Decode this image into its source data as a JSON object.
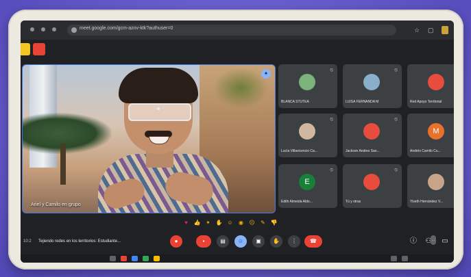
{
  "browser": {
    "url": "meet.google.com/gcm-aznv-ktk?authuser=0",
    "star_icon": "star-icon",
    "extensions_icon": "puzzle-icon"
  },
  "main_speaker": {
    "name": "Ariel y Camilo en grupo"
  },
  "participants": [
    {
      "name": "BLANCA STUTEA",
      "avatar": "",
      "color": "#7bb37a",
      "photo": true
    },
    {
      "name": "LUISA FERNANDA M",
      "avatar": "",
      "color": "#8ab0c9",
      "photo": true
    },
    {
      "name": "Red Apoyo Territorial",
      "avatar": "",
      "color": "#e74c3c",
      "photo": true
    },
    {
      "name": "Lucía Villavicencio Ca...",
      "avatar": "",
      "color": "#d0b8a0",
      "photo": true
    },
    {
      "name": "Jackson Andres Sao...",
      "avatar": "",
      "color": "#e74c3c",
      "photo": true
    },
    {
      "name": "Andrés Camilo Cu...",
      "avatar": "M",
      "color": "#e8712c",
      "photo": false
    },
    {
      "name": "Edith Almeida Aldo...",
      "avatar": "E",
      "color": "#188038",
      "photo": false
    },
    {
      "name": "Tú y otras",
      "avatar": "",
      "color": "#e74c3c",
      "photo": true
    },
    {
      "name": "Yiseth Hernández V...",
      "avatar": "",
      "color": "#c7a48a",
      "photo": true
    }
  ],
  "reactions": [
    "heart",
    "thumbs-up",
    "party",
    "clap",
    "laugh",
    "surprised",
    "sad",
    "thinking",
    "thumbs-down"
  ],
  "bottom_bar": {
    "time": "10:2",
    "meeting_title": "Tejiendo redes en los territorios: Estudiante..."
  },
  "colors": {
    "accent_blue": "#8ab4f8",
    "end_call_red": "#ea4335",
    "meet_bg": "#202124"
  }
}
